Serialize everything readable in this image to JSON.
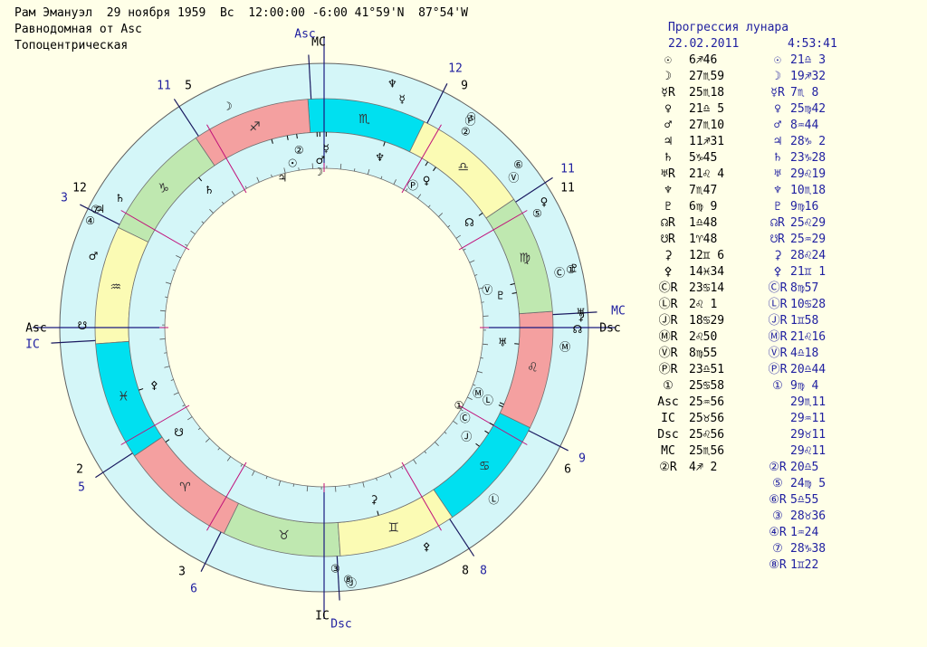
{
  "header": {
    "line1": "Рам Эмануэл  29 ноября 1959  Вс  12:00:00 -6:00 41°59'N  87°54'W",
    "line2": "Равнодомная от Asc",
    "line3": "Топоцентрическая"
  },
  "progression": {
    "title": "Прогрессия лунара",
    "date": "22.02.2011",
    "time": "4:53:41"
  },
  "colors": {
    "background": "#ffffe8",
    "outer_ring": "#d4f6f8",
    "fire": "#f4a0a0",
    "earth": "#bfe8b0",
    "air": "#fbfbb4",
    "water": "#00e0f0",
    "house_line": "#c0107a",
    "text_blue": "#2020a0"
  },
  "table_rows": [
    {
      "g1": "☉",
      "v1": "6♐46",
      "g2": "☉",
      "v2": "21♎ 3"
    },
    {
      "g1": "☽",
      "v1": "27♏59",
      "g2": "☽",
      "v2": "19♐32"
    },
    {
      "g1": "☿R",
      "v1": "25♏18",
      "g2": "☿R",
      "v2": "7♏ 8"
    },
    {
      "g1": "♀",
      "v1": "21♎ 5",
      "g2": "♀",
      "v2": "25♍42"
    },
    {
      "g1": "♂",
      "v1": "27♏10",
      "g2": "♂",
      "v2": "8♒44"
    },
    {
      "g1": "♃",
      "v1": "11♐31",
      "g2": "♃",
      "v2": "28♑ 2"
    },
    {
      "g1": "♄",
      "v1": "5♑45",
      "g2": "♄",
      "v2": "23♑28"
    },
    {
      "g1": "♅R",
      "v1": "21♌ 4",
      "g2": "♅",
      "v2": "29♌19"
    },
    {
      "g1": "♆",
      "v1": "7♏47",
      "g2": "♆",
      "v2": "10♏18"
    },
    {
      "g1": "♇",
      "v1": "6♍ 9",
      "g2": "♇",
      "v2": "9♍16"
    },
    {
      "g1": "☊R",
      "v1": "1♎48",
      "g2": "☊R",
      "v2": "25♌29"
    },
    {
      "g1": "☋R",
      "v1": "1♈48",
      "g2": "☋R",
      "v2": "25♒29"
    },
    {
      "g1": "⚳",
      "v1": "12♊ 6",
      "g2": "⚳",
      "v2": "28♌24"
    },
    {
      "g1": "⚴",
      "v1": "14♓34",
      "g2": "⚴",
      "v2": "21♊ 1"
    },
    {
      "g1": "ⒸR",
      "v1": "23♋14",
      "g2": "ⒸR",
      "v2": "8♍57"
    },
    {
      "g1": "ⓁR",
      "v1": "2♌ 1",
      "g2": "ⓁR",
      "v2": "10♋28"
    },
    {
      "g1": "ⒿR",
      "v1": "18♋29",
      "g2": "ⒿR",
      "v2": "1♊58"
    },
    {
      "g1": "ⓂR",
      "v1": "2♌50",
      "g2": "ⓂR",
      "v2": "21♌16"
    },
    {
      "g1": "ⓋR",
      "v1": "8♍55",
      "g2": "ⓋR",
      "v2": "4♎18"
    },
    {
      "g1": "ⓅR",
      "v1": "23♎51",
      "g2": "ⓅR",
      "v2": "20♎44"
    },
    {
      "g1": "①",
      "v1": "25♋58",
      "g2": "①",
      "v2": "9♍ 4"
    },
    {
      "g1": "Asc",
      "v1": "25♒56",
      "g2": "",
      "v2": "29♏11"
    },
    {
      "g1": "IC",
      "v1": "25♉56",
      "g2": "",
      "v2": "29♒11"
    },
    {
      "g1": "Dsc",
      "v1": "25♌56",
      "g2": "",
      "v2": "29♉11"
    },
    {
      "g1": "MC",
      "v1": "25♏56",
      "g2": "",
      "v2": "29♌11"
    },
    {
      "g1": "②R",
      "v1": "4♐ 2",
      "g2": "②R",
      "v2": "20♎5"
    },
    {
      "g1": "",
      "v1": "",
      "g2": "⑤",
      "v2": "24♍ 5"
    },
    {
      "g1": "",
      "v1": "",
      "g2": "⑥R",
      "v2": "5♎55"
    },
    {
      "g1": "",
      "v1": "",
      "g2": "③",
      "v2": "28♉36"
    },
    {
      "g1": "",
      "v1": "",
      "g2": "④R",
      "v2": "1♒24"
    },
    {
      "g1": "",
      "v1": "",
      "g2": "⑦",
      "v2": "28♑38"
    },
    {
      "g1": "",
      "v1": "",
      "g2": "⑧R",
      "v2": "1♊22"
    }
  ],
  "wheel": {
    "sign_glyphs": [
      "♈",
      "♉",
      "♊",
      "♋",
      "♌",
      "♍",
      "♎",
      "♏",
      "♐",
      "♑",
      "♒",
      "♓"
    ],
    "angle_labels": {
      "natal_asc": "Asc",
      "natal_mc": "MC",
      "natal_ic": "IC",
      "natal_dsc": "Dsc",
      "prog_asc": "Asc",
      "prog_ic": "IC",
      "prog_mc": "MC",
      "prog_dsc": "Dsc"
    },
    "natal_house_numbers": [
      {
        "n": "2"
      },
      {
        "n": "3"
      },
      {
        "n": "5"
      },
      {
        "n": "6"
      },
      {
        "n": "8"
      },
      {
        "n": "9"
      },
      {
        "n": "11"
      },
      {
        "n": "12"
      }
    ],
    "prog_house_numbers": [
      {
        "n": "11"
      },
      {
        "n": "3"
      },
      {
        "n": "5"
      },
      {
        "n": "6"
      },
      {
        "n": "8"
      },
      {
        "n": "9"
      },
      {
        "n": "11"
      },
      {
        "n": "12"
      }
    ],
    "natal_planets": [
      {
        "g": "☉",
        "lon": 246.8
      },
      {
        "g": "☽",
        "lon": 238.0
      },
      {
        "g": "☿",
        "lon": 235.3
      },
      {
        "g": "♀",
        "lon": 201.1
      },
      {
        "g": "♂",
        "lon": 237.2
      },
      {
        "g": "♃",
        "lon": 251.5
      },
      {
        "g": "♄",
        "lon": 275.8
      },
      {
        "g": "♅",
        "lon": 141.1
      },
      {
        "g": "♆",
        "lon": 217.8
      },
      {
        "g": "♇",
        "lon": 156.2
      },
      {
        "g": "☊",
        "lon": 181.8
      },
      {
        "g": "☋",
        "lon": 1.8
      },
      {
        "g": "⚳",
        "lon": 72.1
      },
      {
        "g": "⚴",
        "lon": 344.6
      },
      {
        "g": "Ⓒ",
        "lon": 113.2
      },
      {
        "g": "Ⓛ",
        "lon": 122.0
      },
      {
        "g": "Ⓙ",
        "lon": 108.5
      },
      {
        "g": "Ⓜ",
        "lon": 122.8
      },
      {
        "g": "Ⓥ",
        "lon": 158.9
      },
      {
        "g": "Ⓟ",
        "lon": 203.9
      },
      {
        "g": "①",
        "lon": 115.97
      },
      {
        "g": "②",
        "lon": 244.0
      }
    ],
    "prog_planets": [
      {
        "g": "☉",
        "lon": 201.0
      },
      {
        "g": "☽",
        "lon": 259.5
      },
      {
        "g": "☿",
        "lon": 217.1
      },
      {
        "g": "♀",
        "lon": 175.7
      },
      {
        "g": "♂",
        "lon": 308.7
      },
      {
        "g": "♃",
        "lon": 298.0
      },
      {
        "g": "♄",
        "lon": 293.5
      },
      {
        "g": "♅",
        "lon": 149.3
      },
      {
        "g": "♆",
        "lon": 220.3
      },
      {
        "g": "♇",
        "lon": 159.3
      },
      {
        "g": "☊",
        "lon": 145.5
      },
      {
        "g": "☋",
        "lon": 325.5
      },
      {
        "g": "⚳",
        "lon": 148.4
      },
      {
        "g": "⚴",
        "lon": 81.0
      },
      {
        "g": "Ⓒ",
        "lon": 159.0
      },
      {
        "g": "Ⓛ",
        "lon": 100.5
      },
      {
        "g": "Ⓙ",
        "lon": 62.0
      },
      {
        "g": "Ⓜ",
        "lon": 141.3
      },
      {
        "g": "Ⓥ",
        "lon": 184.3
      },
      {
        "g": "Ⓟ",
        "lon": 200.7
      },
      {
        "g": "①",
        "lon": 159.1
      },
      {
        "g": "②",
        "lon": 200.1
      },
      {
        "g": "⑤",
        "lon": 174.1
      },
      {
        "g": "⑥",
        "lon": 185.9
      },
      {
        "g": "③",
        "lon": 58.6
      },
      {
        "g": "④",
        "lon": 301.4
      },
      {
        "g": "⑦",
        "lon": 298.6
      },
      {
        "g": "⑧",
        "lon": 61.4
      }
    ]
  }
}
